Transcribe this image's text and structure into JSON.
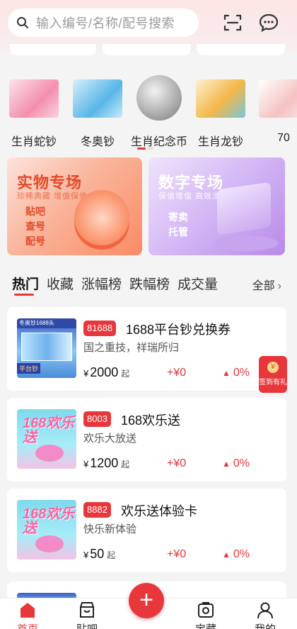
{
  "search": {
    "placeholder": "输入编号/名称/配号搜索"
  },
  "categories": [
    {
      "label": "生肖蛇钞",
      "thumb_color": "#f6a6b8"
    },
    {
      "label": "冬奥钞",
      "thumb_color": "#7cc8ef"
    },
    {
      "label": "生肖纪念币",
      "thumb_color": "#a5a5a5"
    },
    {
      "label": "生肖龙钞",
      "thumb_color": "#f5c55a"
    },
    {
      "label": "70",
      "thumb_color": "#f7c7c7"
    }
  ],
  "banners": {
    "physical": {
      "title": "实物专场",
      "subtitle": "珍稀典藏 增值保值",
      "items": [
        "贴吧",
        "查号",
        "配号"
      ]
    },
    "digital": {
      "title": "数字专场",
      "subtitle": "保值增值 高效流通",
      "items": [
        "寄卖",
        "托管"
      ]
    }
  },
  "tabs": [
    "热门",
    "收藏",
    "涨幅榜",
    "跌幅榜",
    "成交量"
  ],
  "tabs_all": "全部",
  "products": [
    {
      "code": "81688",
      "name": "1688平台钞兑换券",
      "desc": "国之重技，祥瑞所归",
      "currency": "¥",
      "price": "2000",
      "suffix": "起",
      "change": "+¥0",
      "percent": "0%",
      "image_caption": "冬奥钞1688头",
      "image_badge": "平台钞"
    },
    {
      "code": "8003",
      "name": "168欢乐送",
      "desc": "欢乐大放送",
      "currency": "¥",
      "price": "1200",
      "suffix": "起",
      "change": "+¥0",
      "percent": "0%",
      "image_caption": "168欢乐送"
    },
    {
      "code": "8882",
      "name": "欢乐送体验卡",
      "desc": "快乐新体验",
      "currency": "¥",
      "price": "50",
      "suffix": "起",
      "change": "+¥0",
      "percent": "0%",
      "image_caption": "168欢乐送"
    }
  ],
  "signin": {
    "icon": "¥",
    "label": "签到有礼"
  },
  "close_symbol": "×",
  "up_symbol": "▲",
  "nav": [
    {
      "label": "首页",
      "icon": "home-icon",
      "active": true
    },
    {
      "label": "贴吧",
      "icon": "shop-icon",
      "active": false
    },
    {
      "label": "宝藏",
      "icon": "treasure-icon",
      "active": false
    },
    {
      "label": "我的",
      "icon": "user-icon",
      "active": false
    }
  ],
  "fab_symbol": "+",
  "colors": {
    "accent": "#e8373b"
  }
}
